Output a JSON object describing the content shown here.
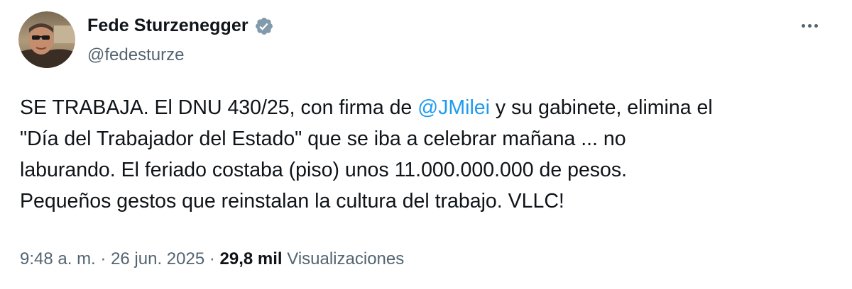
{
  "author": {
    "name": "Fede Sturzenegger",
    "handle": "@fedesturze",
    "verified": true
  },
  "icons": {
    "verified": "verified-badge-icon",
    "more": "more-horizontal-icon"
  },
  "tweet": {
    "line1_before": "SE TRABAJA. El DNU 430/25, con firma de ",
    "mention": "@JMilei",
    "line1_after": " y su gabinete, elimina el",
    "line2": "\"Día del Trabajador del Estado\" que se iba a celebrar mañana ... no",
    "line3": "laburando. El feriado costaba (piso) unos 11.000.000.000 de pesos.",
    "line4": "Pequeños gestos que reinstalan la cultura del trabajo. VLLC!"
  },
  "meta": {
    "time": "9:48 a. m.",
    "separator": " · ",
    "date": "26 jun. 2025",
    "separator2": " · ",
    "views_count": "29,8 mil",
    "views_label": "Visualizaciones"
  },
  "colors": {
    "text": "#0f1419",
    "secondary": "#536471",
    "link": "#1d9bf0",
    "verified": "#829aab"
  }
}
